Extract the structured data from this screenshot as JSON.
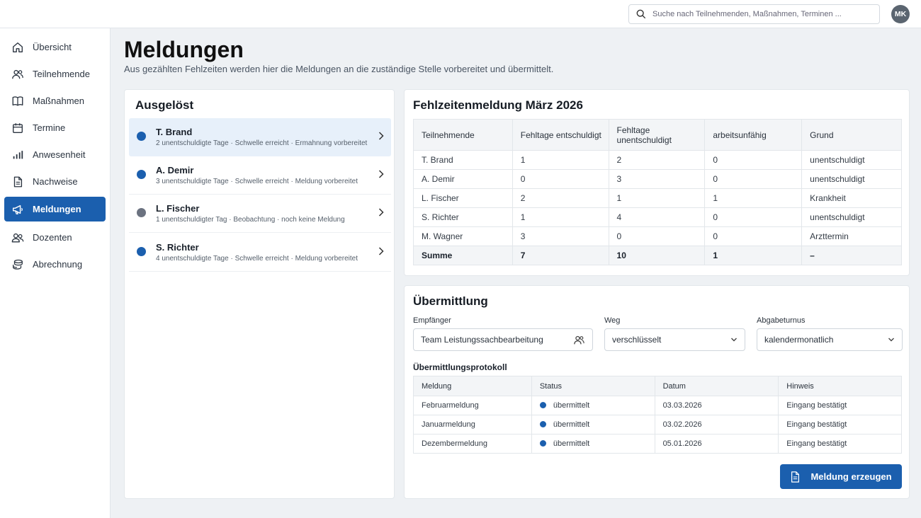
{
  "search": {
    "placeholder": "Suche nach Teilnehmenden, Maßnahmen, Terminen ..."
  },
  "user": {
    "initials": "MK"
  },
  "sidebar": {
    "items": [
      {
        "label": "Übersicht",
        "icon": "home-icon"
      },
      {
        "label": "Teilnehmende",
        "icon": "users-icon"
      },
      {
        "label": "Maßnahmen",
        "icon": "book-icon"
      },
      {
        "label": "Termine",
        "icon": "calendar-icon"
      },
      {
        "label": "Anwesenheit",
        "icon": "bar-chart-icon"
      },
      {
        "label": "Nachweise",
        "icon": "document-icon"
      },
      {
        "label": "Meldungen",
        "icon": "megaphone-icon",
        "active": true
      },
      {
        "label": "Dozenten",
        "icon": "people-icon"
      },
      {
        "label": "Abrechnung",
        "icon": "coins-icon"
      }
    ]
  },
  "page": {
    "title": "Meldungen",
    "subtitle": "Aus gezählten Fehlzeiten werden hier die Meldungen an die zuständige Stelle vorbereitet und übermittelt."
  },
  "triggered": {
    "title": "Ausgelöst",
    "items": [
      {
        "name": "T. Brand",
        "desc": "2 unentschuldigte Tage · Schwelle erreicht · Ermahnung vorbereitet",
        "color": "#1b5fae"
      },
      {
        "name": "A. Demir",
        "desc": "3 unentschuldigte Tage · Schwelle erreicht · Meldung vorbereitet",
        "color": "#1b5fae"
      },
      {
        "name": "L. Fischer",
        "desc": "1 unentschuldigter Tag · Beobachtung · noch keine Meldung",
        "color": "#6b7280"
      },
      {
        "name": "S. Richter",
        "desc": "4 unentschuldigte Tage · Schwelle erreicht · Meldung vorbereitet",
        "color": "#1b5fae"
      }
    ]
  },
  "report": {
    "title": "Fehlzeitenmeldung März 2026",
    "headers": [
      "Teilnehmende",
      "Fehltage entschuldigt",
      "Fehltage unentschuldigt",
      "arbeitsunfähig",
      "Grund"
    ],
    "rows": [
      [
        "T. Brand",
        "1",
        "2",
        "0",
        "unentschuldigt"
      ],
      [
        "A. Demir",
        "0",
        "3",
        "0",
        "unentschuldigt"
      ],
      [
        "L. Fischer",
        "2",
        "1",
        "1",
        "Krankheit"
      ],
      [
        "S. Richter",
        "1",
        "4",
        "0",
        "unentschuldigt"
      ],
      [
        "M. Wagner",
        "3",
        "0",
        "0",
        "Arzttermin"
      ]
    ],
    "sum": [
      "Summe",
      "7",
      "10",
      "1",
      "–"
    ]
  },
  "transfer": {
    "title": "Übermittlung",
    "recipient_label": "Empfänger",
    "recipient_value": "Team Leistungssachbearbeitung",
    "way_label": "Weg",
    "way_value": "verschlüsselt",
    "cycle_label": "Abgabeturnus",
    "cycle_value": "kalendermonatlich",
    "log_title": "Übermittlungsprotokoll",
    "log_headers": [
      "Meldung",
      "Status",
      "Datum",
      "Hinweis"
    ],
    "log_rows": [
      [
        "Februarmeldung",
        "übermittelt",
        "03.03.2026",
        "Eingang bestätigt"
      ],
      [
        "Januarmeldung",
        "übermittelt",
        "03.02.2026",
        "Eingang bestätigt"
      ],
      [
        "Dezembermeldung",
        "übermittelt",
        "05.01.2026",
        "Eingang bestätigt"
      ]
    ],
    "button_label": "Meldung erzeugen"
  },
  "colors": {
    "accent": "#1b5fae",
    "neutral_dot": "#6b7280"
  }
}
